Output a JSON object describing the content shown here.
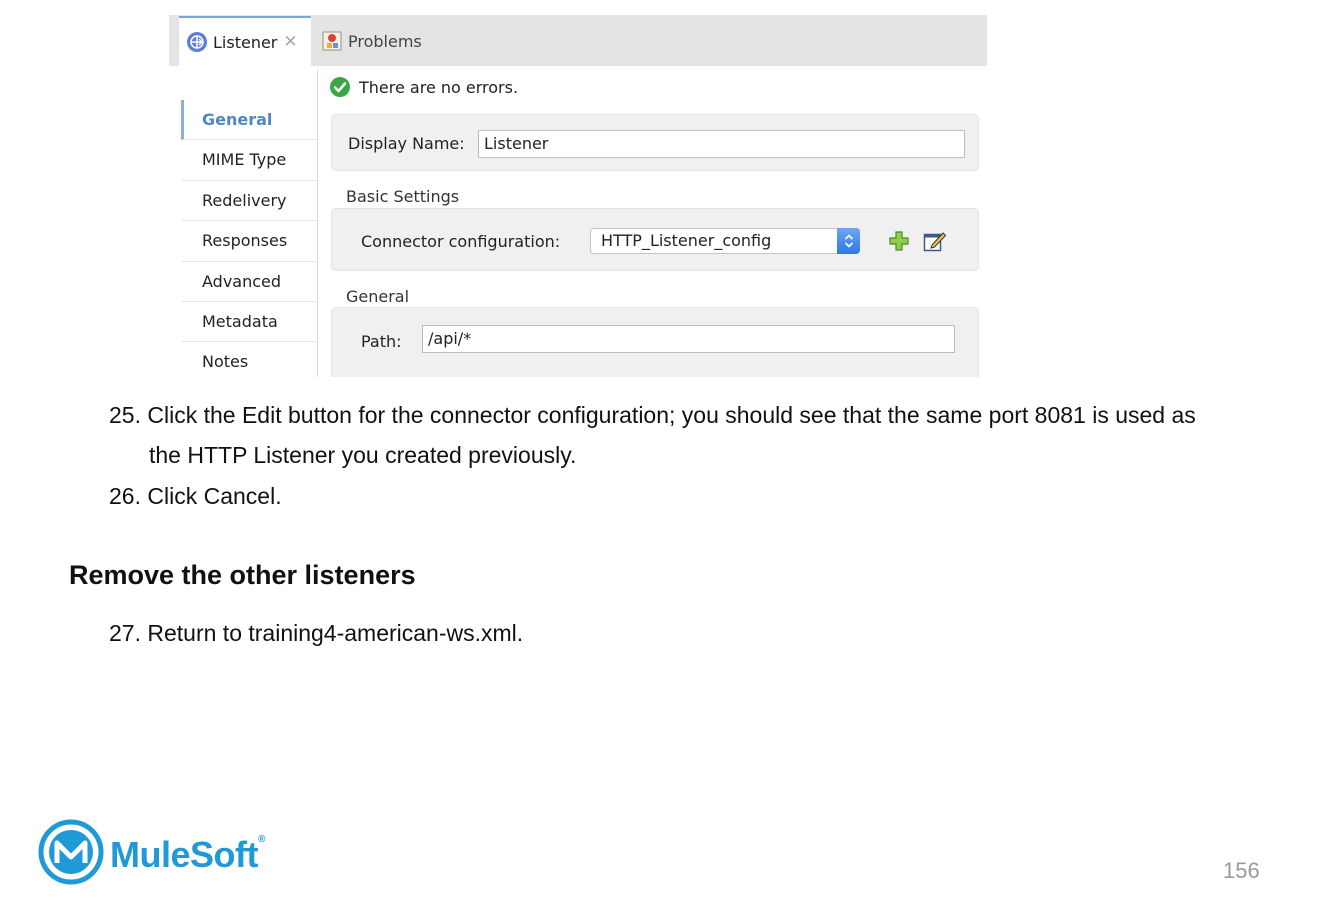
{
  "ide": {
    "tabs": [
      {
        "label": "Listener",
        "icon": "listener-globe-icon",
        "closable": true,
        "active": true
      },
      {
        "label": "Problems",
        "icon": "problems-icon",
        "active": false
      }
    ],
    "status_message": "There are no errors.",
    "nav_items": [
      "General",
      "MIME Type",
      "Redelivery",
      "Responses",
      "Advanced",
      "Metadata",
      "Notes"
    ],
    "active_nav": "General",
    "display_name_label": "Display Name:",
    "display_name_value": "Listener",
    "basic_settings_title": "Basic Settings",
    "connector_config_label": "Connector configuration:",
    "connector_config_value": "HTTP_Listener_config",
    "general_title": "General",
    "path_label": "Path:",
    "path_value": "/api/*",
    "colors": {
      "accent": "#4f86c6",
      "select_button": "#2f77e6",
      "success": "#3aa645"
    }
  },
  "steps": [
    {
      "number": "25.",
      "text_line1": "Click the Edit button for the connector configuration; you should see that the same port 8081 is used as",
      "text_line2": "the HTTP Listener you created previously."
    },
    {
      "number": "26.",
      "text_line1": "Click Cancel."
    }
  ],
  "section_heading": "Remove the other listeners",
  "steps2": [
    {
      "number": "27.",
      "text_line1": "Return to training4-american-ws.xml."
    }
  ],
  "footer": {
    "logo_text": "MuleSoft",
    "logo_mark": "®",
    "page_number": "156",
    "brand_color": "#1f9ad6"
  }
}
